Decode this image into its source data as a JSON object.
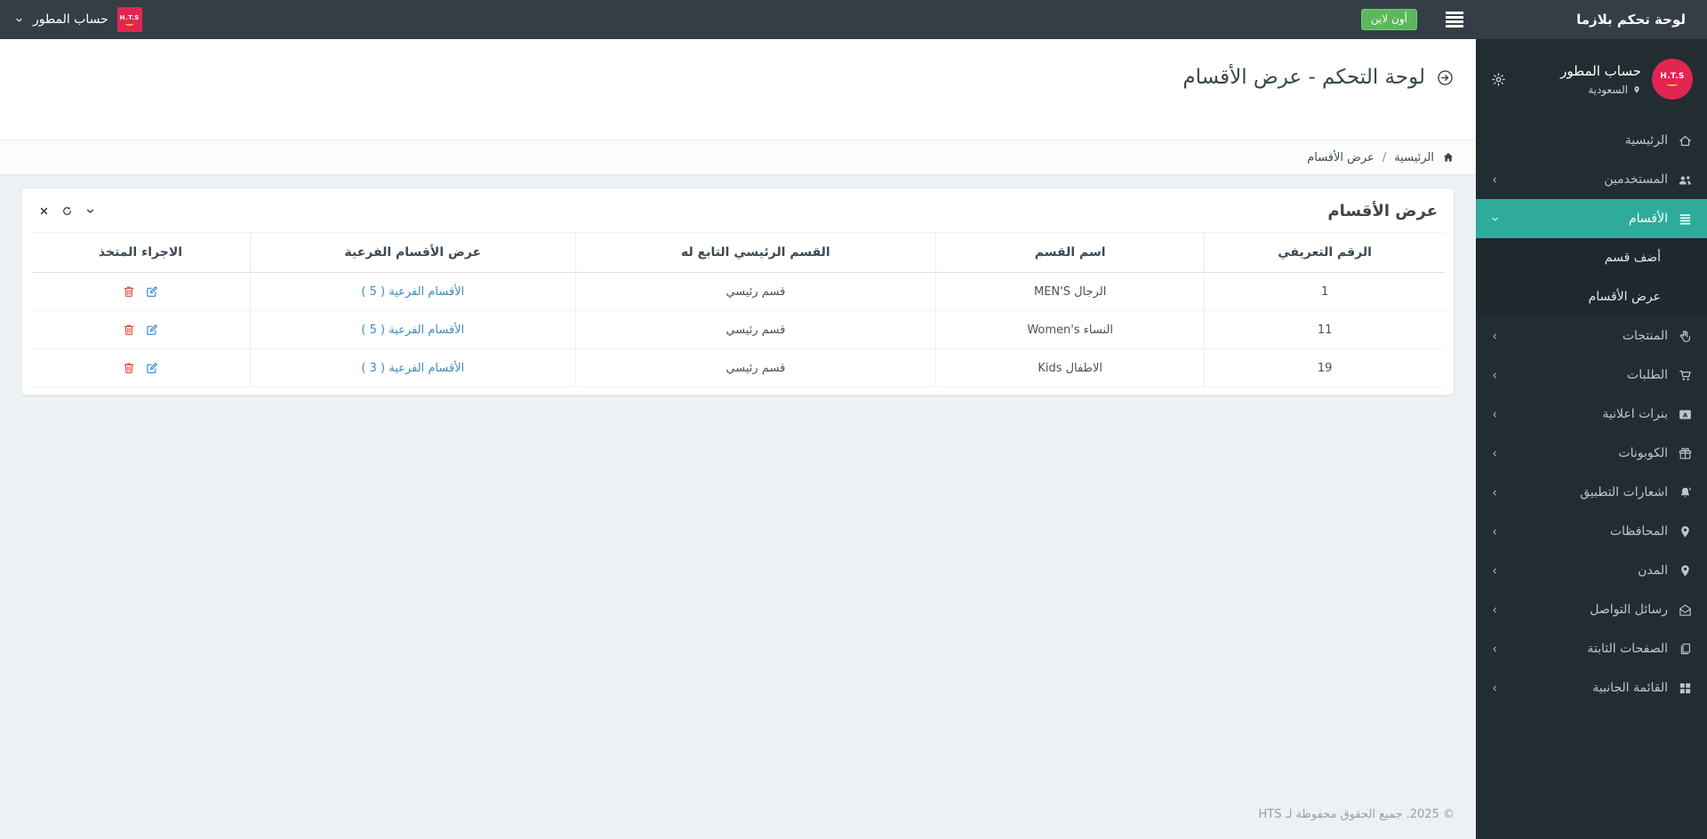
{
  "topbar": {
    "brand": "لوحة تحكم بلازما",
    "online_badge": "أون لاين",
    "account": {
      "label": "حساب المطور",
      "logo": "H.T.S"
    }
  },
  "sidebar": {
    "user": {
      "name": "حساب المطور",
      "location": "السعودية",
      "avatar": "H.T.S"
    },
    "menu": [
      {
        "label": "الرئيسية",
        "icon": "i-home"
      },
      {
        "label": "المستخدمين",
        "icon": "i-users",
        "chevron": "left"
      },
      {
        "label": "الأقسام",
        "icon": "i-list",
        "chevron": "down",
        "active": true,
        "children": [
          {
            "label": "أضف قسم"
          },
          {
            "label": "عرض الأقسام"
          }
        ]
      },
      {
        "label": "المنتجات",
        "icon": "i-hand",
        "chevron": "left"
      },
      {
        "label": "الطلبات",
        "icon": "i-cart",
        "chevron": "left"
      },
      {
        "label": "بنرات اعلانية",
        "icon": "i-ad",
        "chevron": "left"
      },
      {
        "label": "الكوبونات",
        "icon": "i-gift",
        "chevron": "left"
      },
      {
        "label": "اشعارات التطبيق",
        "icon": "i-bell",
        "chevron": "left"
      },
      {
        "label": "المحافظات",
        "icon": "i-pin",
        "chevron": "left"
      },
      {
        "label": "المدن",
        "icon": "i-pin",
        "chevron": "left"
      },
      {
        "label": "رسائل التواصل",
        "icon": "i-mail",
        "chevron": "left"
      },
      {
        "label": "الصفحات الثابتة",
        "icon": "i-pages",
        "chevron": "left"
      },
      {
        "label": "القائمة الجانبية",
        "icon": "i-grid",
        "chevron": "left"
      }
    ]
  },
  "page": {
    "title": "لوحة التحكم - عرض الأقسام",
    "breadcrumb": {
      "home": "الرئيسية",
      "sep": "/",
      "current": "عرض الأقسام"
    },
    "panel_title": "عرض الأقسام"
  },
  "table": {
    "headers": [
      "الرقم التعريفي",
      "اسم القسم",
      "القسم الرئيسي التابع له",
      "عرض الأقسام الفرعية",
      "الاجراء المتخذ"
    ],
    "rows": [
      {
        "id": "1",
        "name": "الرجال MEN'S",
        "parent": "قسم رئيسي",
        "subcats": "الأقسام الفرعية ( 5 )"
      },
      {
        "id": "11",
        "name": "النساء Women's",
        "parent": "قسم رئيسي",
        "subcats": "الأقسام الفرعية ( 5 )"
      },
      {
        "id": "19",
        "name": "الاطفال Kids",
        "parent": "قسم رئيسي",
        "subcats": "الأقسام الفرعية ( 3 )"
      }
    ]
  },
  "footer": {
    "copyright": "© 2025. جميع الحقوق محفوظة لـ HTS"
  },
  "colors": {
    "topbar_bg": "#353e46",
    "sidebar_bg": "#222d32",
    "accent_teal": "#2fab9c",
    "brand_red": "#e32552",
    "online_green": "#5cb85c",
    "link_blue": "#3c8dbc",
    "edit_blue": "#2e86de",
    "danger_red": "#dd4b39"
  }
}
